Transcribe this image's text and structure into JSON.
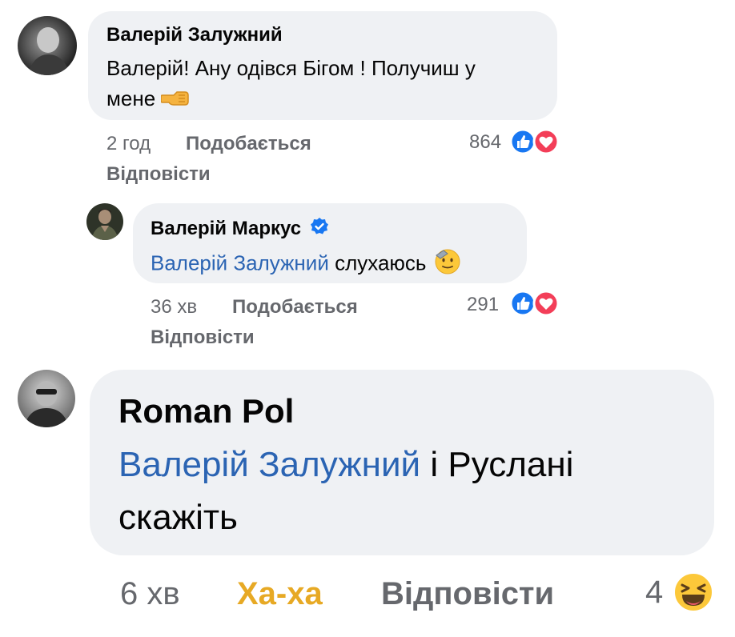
{
  "comments": [
    {
      "author": "Валерій Залужний",
      "text_line1": "Валерій! Ану одівся Бігом ! Получиш у",
      "text_line2": "мене",
      "time": "2 год",
      "like_label": "Подобається",
      "reply_label": "Відповісти",
      "reaction_count": "864",
      "reaction_icons": [
        "like-reaction-icon",
        "love-reaction-icon"
      ],
      "trailing_emoji": "pointing-fist-icon"
    },
    {
      "author": "Валерій Маркус",
      "verified": true,
      "mention": "Валерій Залужний",
      "text": " слухаюсь",
      "time": "36 хв",
      "like_label": "Подобається",
      "reply_label": "Відповісти",
      "reaction_count": "291",
      "reaction_icons": [
        "like-reaction-icon",
        "love-reaction-icon"
      ],
      "trailing_emoji": "saluting-face-icon"
    },
    {
      "author": "Roman Pol",
      "mention": "Валерій Залужний",
      "text_line1": " і Руслані",
      "text_line2": "скажіть",
      "time": "6 хв",
      "reaction_label": "Ха-ха",
      "reply_label": "Відповісти",
      "reaction_count": "4",
      "reaction_icons": [
        "haha-reaction-icon"
      ]
    }
  ],
  "colors": {
    "bubble": "#eff1f4",
    "mention": "#2b64b3",
    "meta": "#66686d",
    "haha": "#e7a924",
    "like": "#1877f2",
    "love": "#f33e58",
    "verified": "#1877f2"
  }
}
